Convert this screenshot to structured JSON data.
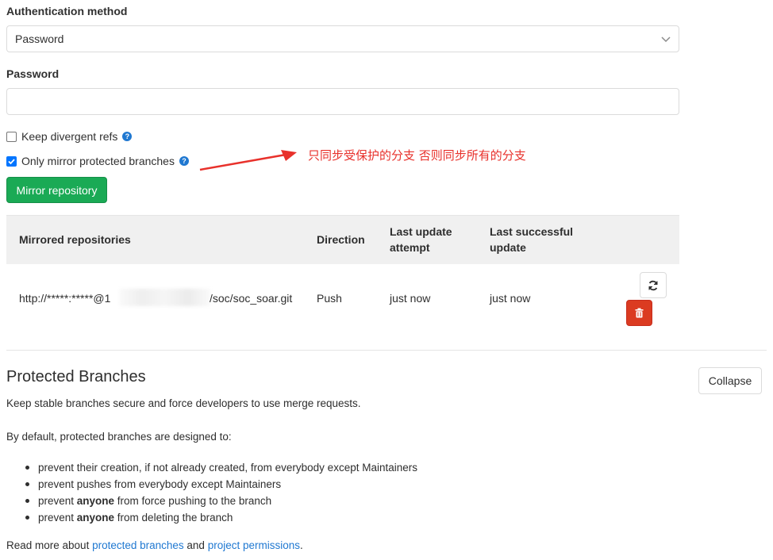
{
  "auth": {
    "label": "Authentication method",
    "selected": "Password"
  },
  "password": {
    "label": "Password",
    "value": ""
  },
  "options": {
    "keep_divergent_label": "Keep divergent refs",
    "keep_divergent_checked": false,
    "only_protected_label": "Only mirror protected branches",
    "only_protected_checked": true
  },
  "annotation": {
    "text": "只同步受保护的分支 否则同步所有的分支",
    "color": "#e8312b"
  },
  "mirror_button": "Mirror repository",
  "table": {
    "headers": {
      "repo": "Mirrored repositories",
      "direction": "Direction",
      "last_attempt_1": "Last update",
      "last_attempt_2": "attempt",
      "last_success_1": "Last successful",
      "last_success_2": "update"
    },
    "rows": [
      {
        "url_start": "http://*****:*****@1",
        "url_end": "/soc/soc_soar.git",
        "direction": "Push",
        "last_attempt": "just now",
        "last_success": "just now"
      }
    ]
  },
  "protected": {
    "title": "Protected Branches",
    "collapse": "Collapse",
    "description": "Keep stable branches secure and force developers to use merge requests.",
    "intro": "By default, protected branches are designed to:",
    "rules": [
      {
        "pre": "prevent their creation, if not already created, from everybody except Maintainers",
        "bold": "",
        "post": ""
      },
      {
        "pre": "prevent pushes from everybody except Maintainers",
        "bold": "",
        "post": ""
      },
      {
        "pre": "prevent ",
        "bold": "anyone",
        "post": " from force pushing to the branch"
      },
      {
        "pre": "prevent ",
        "bold": "anyone",
        "post": " from deleting the branch"
      }
    ],
    "read_more_pre": "Read more about ",
    "link_protected": "protected branches",
    "read_more_mid": " and ",
    "link_permissions": "project permissions",
    "read_more_post": "."
  },
  "colors": {
    "success": "#1aaa55",
    "danger": "#db3b21",
    "link": "#1f78d1"
  }
}
